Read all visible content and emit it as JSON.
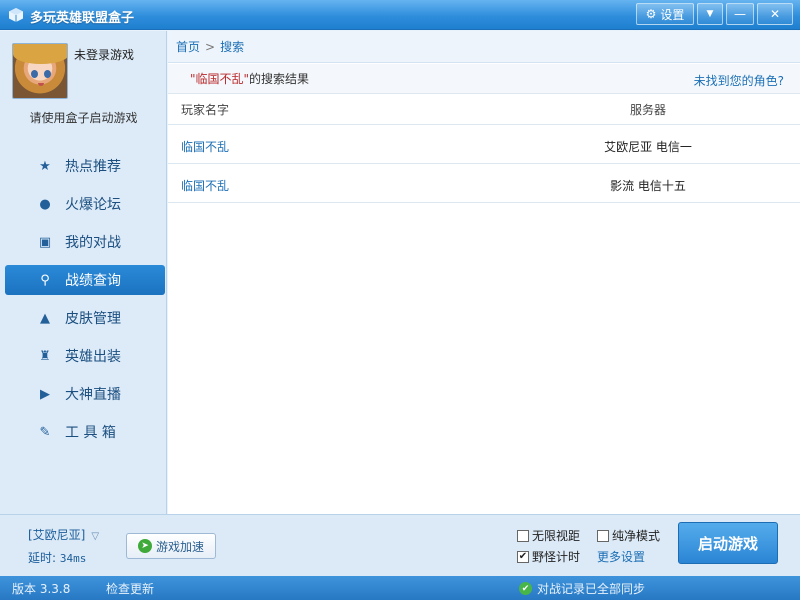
{
  "window": {
    "title": "多玩英雄联盟盒子",
    "settings_label": "设置",
    "menu_glyph": "▼",
    "min_glyph": "—",
    "close_glyph": "✕"
  },
  "profile": {
    "status": "未登录游戏",
    "hint": "请使用盒子启动游戏"
  },
  "sidebar": {
    "items": [
      {
        "label": "热点推荐",
        "icon": "star-icon",
        "glyph": "★"
      },
      {
        "label": "火爆论坛",
        "icon": "chat-icon",
        "glyph": "●"
      },
      {
        "label": "我的对战",
        "icon": "battle-icon",
        "glyph": "▣"
      },
      {
        "label": "战绩查询",
        "icon": "search-icon",
        "glyph": "⚲"
      },
      {
        "label": "皮肤管理",
        "icon": "hat-icon",
        "glyph": "▲"
      },
      {
        "label": "英雄出装",
        "icon": "armor-icon",
        "glyph": "♜"
      },
      {
        "label": "大神直播",
        "icon": "play-icon",
        "glyph": "▶"
      },
      {
        "label": "工 具 箱",
        "icon": "tools-icon",
        "glyph": "✎"
      }
    ],
    "active_index": 3
  },
  "breadcrumb": {
    "home": "首页",
    "sep": ">",
    "current": "搜索"
  },
  "search": {
    "query_display": "\"临国不乱\"",
    "suffix": " 的搜索结果",
    "not_found": "未找到您的角色?"
  },
  "table": {
    "headers": [
      "玩家名字",
      "服务器"
    ],
    "rows": [
      {
        "player": "临国不乱",
        "server": "艾欧尼亚 电信一"
      },
      {
        "player": "临国不乱",
        "server": "影流 电信十五"
      }
    ]
  },
  "bottom": {
    "server": "[艾欧尼亚]",
    "latency_label": "延时:",
    "latency_value": "34ms",
    "accelerate_label": "游戏加速",
    "opt_unlimited_view": "无限视距",
    "opt_pure_mode": "纯净模式",
    "opt_jungle_timer": "野怪计时",
    "more_settings": "更多设置",
    "launch_label": "启动游戏"
  },
  "status": {
    "version": "版本 3.3.8",
    "check_update": "检查更新",
    "sync": "对战记录已全部同步"
  },
  "colors": {
    "accent": "#2a8ad8",
    "link": "#1c6fb5",
    "query": "#b8282a",
    "ok": "#48b548"
  }
}
